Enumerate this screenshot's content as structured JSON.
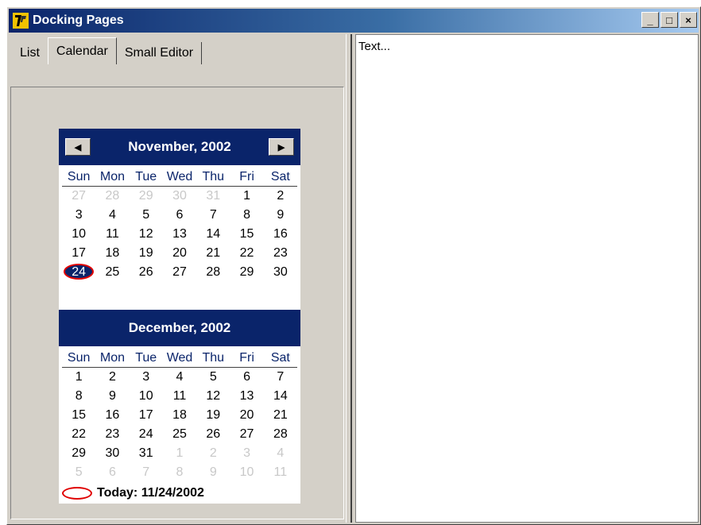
{
  "window": {
    "title": "Docking Pages",
    "minimize": "_",
    "maximize": "□",
    "close": "×"
  },
  "tabs": [
    "List",
    "Calendar",
    "Small Editor"
  ],
  "editor": {
    "text": "Text..."
  },
  "calendar": {
    "weekdays": [
      "Sun",
      "Mon",
      "Tue",
      "Wed",
      "Thu",
      "Fri",
      "Sat"
    ],
    "months": [
      {
        "title": "November, 2002",
        "days": [
          "27",
          "28",
          "29",
          "30",
          "31",
          "1",
          "2",
          "3",
          "4",
          "5",
          "6",
          "7",
          "8",
          "9",
          "10",
          "11",
          "12",
          "13",
          "14",
          "15",
          "16",
          "17",
          "18",
          "19",
          "20",
          "21",
          "22",
          "23",
          "24",
          "25",
          "26",
          "27",
          "28",
          "29",
          "30"
        ],
        "other_month": [
          true,
          true,
          true,
          true,
          true,
          false,
          false,
          false,
          false,
          false,
          false,
          false,
          false,
          false,
          false,
          false,
          false,
          false,
          false,
          false,
          false,
          false,
          false,
          false,
          false,
          false,
          false,
          false,
          false,
          false,
          false,
          false,
          false,
          false,
          false
        ],
        "today_index": 28
      },
      {
        "title": "December, 2002",
        "days": [
          "1",
          "2",
          "3",
          "4",
          "5",
          "6",
          "7",
          "8",
          "9",
          "10",
          "11",
          "12",
          "13",
          "14",
          "15",
          "16",
          "17",
          "18",
          "19",
          "20",
          "21",
          "22",
          "23",
          "24",
          "25",
          "26",
          "27",
          "28",
          "29",
          "30",
          "31",
          "1",
          "2",
          "3",
          "4",
          "5",
          "6",
          "7",
          "8",
          "9",
          "10",
          "11"
        ],
        "other_month": [
          false,
          false,
          false,
          false,
          false,
          false,
          false,
          false,
          false,
          false,
          false,
          false,
          false,
          false,
          false,
          false,
          false,
          false,
          false,
          false,
          false,
          false,
          false,
          false,
          false,
          false,
          false,
          false,
          false,
          false,
          false,
          true,
          true,
          true,
          true,
          true,
          true,
          true,
          true,
          true,
          true,
          true
        ],
        "today_index": -1
      }
    ],
    "today_label": "Today: 11/24/2002"
  }
}
